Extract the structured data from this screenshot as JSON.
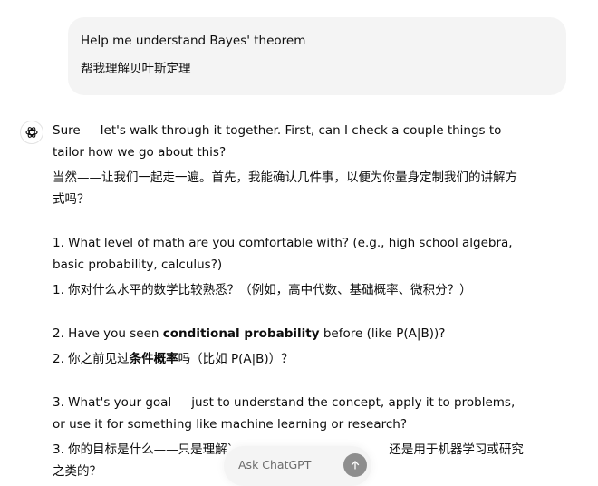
{
  "user_message": {
    "line_en": "Help me understand Bayes' theorem",
    "line_zh": "帮我理解贝叶斯定理"
  },
  "assistant": {
    "intro_en": "Sure — let's walk through it together. First, can I check a couple things to tailor how we go about this?",
    "intro_zh": "当然——让我们一起走一遍。首先，我能确认几件事，以便为你量身定制我们的讲解方式吗？",
    "q1_en": "1. What level of math are you comfortable with? (e.g., high school algebra, basic probability, calculus?)",
    "q1_zh": "1. 你对什么水平的数学比较熟悉？（例如，高中代数、基础概率、微积分？）",
    "q2_en_prefix": "2. Have you seen ",
    "q2_en_bold": "conditional probability",
    "q2_en_suffix": " before (like P(A|B))?",
    "q2_zh_prefix": "2. 你之前见过",
    "q2_zh_bold": "条件概率",
    "q2_zh_suffix": "吗（比如 P(A|B)）？",
    "q3_en": "3. What's your goal — just to understand the concept, apply it to problems, or use it for something like machine learning or research?",
    "q3_zh_prefix": "3. 你的目标是什么——只是理解`",
    "q3_zh_suffix": "还是用于机器学习或研究之类的？"
  },
  "composer": {
    "placeholder": "Ask ChatGPT",
    "send_icon": "arrow-up-icon"
  },
  "colors": {
    "user_bubble_bg": "#f4f4f4",
    "send_button_bg": "#8e8e8e"
  }
}
